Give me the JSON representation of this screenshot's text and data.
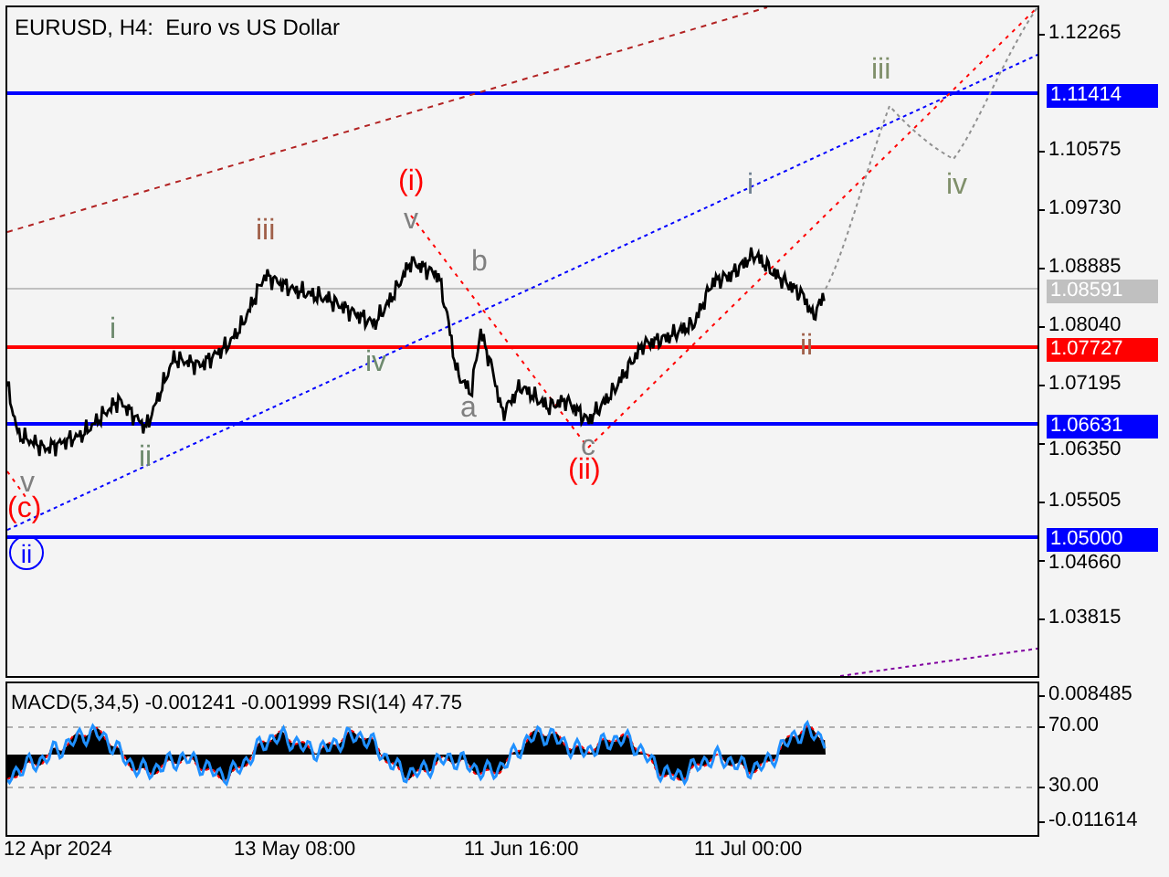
{
  "chart": {
    "title": "EURUSD, H4:  Euro vs US Dollar",
    "wave_labels": [
      {
        "text": "(i)",
        "color": "#ff0000",
        "kind": "plain"
      },
      {
        "text": "iii",
        "color": "#a0604a",
        "kind": "plain"
      },
      {
        "text": "v",
        "color": "#808080",
        "kind": "plain"
      },
      {
        "text": "b",
        "color": "#808080",
        "kind": "plain"
      },
      {
        "text": "i",
        "color": "#6e8a6e",
        "kind": "plain"
      },
      {
        "text": "iv",
        "color": "#6e8a6e",
        "kind": "plain"
      },
      {
        "text": "a",
        "color": "#808080",
        "kind": "plain"
      },
      {
        "text": "ii",
        "color": "#6e8a6e",
        "kind": "plain"
      },
      {
        "text": "c",
        "color": "#808080",
        "kind": "plain"
      },
      {
        "text": "(ii)",
        "color": "#ff0000",
        "kind": "plain"
      },
      {
        "text": "v",
        "color": "#808080",
        "kind": "plain"
      },
      {
        "text": "(c)",
        "color": "#ff0000",
        "kind": "plain"
      },
      {
        "text": "ii",
        "color": "#0000ff",
        "kind": "circled"
      },
      {
        "text": "i",
        "color": "#6e7f90",
        "kind": "plain"
      },
      {
        "text": "ii",
        "color": "#a0604a",
        "kind": "plain"
      },
      {
        "text": "iii",
        "color": "#7f8f6a",
        "kind": "plain"
      },
      {
        "text": "iv",
        "color": "#7f8f6a",
        "kind": "plain"
      }
    ]
  },
  "price_axis": {
    "ticks": [
      "1.12265",
      "1.10575",
      "1.09730",
      "1.08885",
      "1.08040",
      "1.07195",
      "1.06350",
      "1.05505",
      "1.04660",
      "1.03815"
    ],
    "tags": [
      {
        "text": "1.11414",
        "color": "#0000ff"
      },
      {
        "text": "1.08591",
        "color": "#c0c0c0"
      },
      {
        "text": "1.07727",
        "color": "#ff0000"
      },
      {
        "text": "1.06631",
        "color": "#0000ff"
      },
      {
        "text": "1.05000",
        "color": "#0000ff"
      }
    ]
  },
  "indicator": {
    "title": "MACD(5,34,5) -0.001241 -0.001999 RSI(14) 47.75",
    "axis_labels": [
      "0.008485",
      "70.00",
      "30.00",
      "-0.011614"
    ]
  },
  "time_axis": [
    "12 Apr 2024",
    "13 May 08:00",
    "11 Jun 16:00",
    "11 Jul 00:00"
  ]
}
